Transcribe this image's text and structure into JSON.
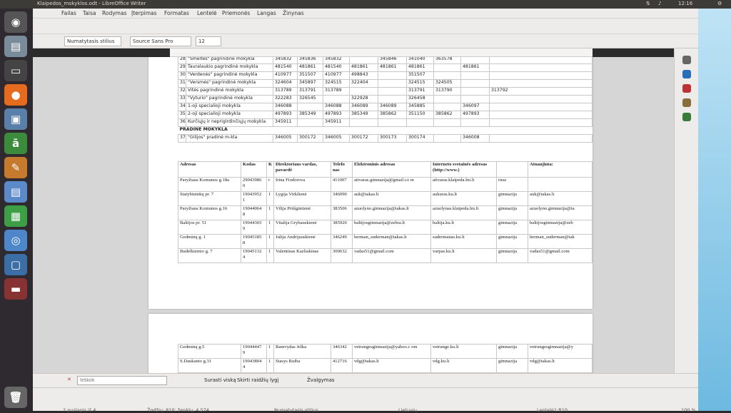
{
  "window": {
    "title": "Klaipedos_mokyklos.odt - LibreOffice Writer",
    "clock": "12:16"
  },
  "menu": [
    "Failas",
    "Taisa",
    "Rodymas",
    "Įterpimas",
    "Formatas",
    "Lentelė",
    "Priemonės",
    "Langas",
    "Žinynas"
  ],
  "toolbar2": {
    "style": "Numatytasis stilius",
    "font": "Source Sans Pro",
    "size": "12"
  },
  "table1": {
    "rows": [
      [
        "28",
        "\"Smeltės\" pagrindinė mokykla",
        "345832",
        "345836",
        "345832",
        "",
        "345846",
        "341040",
        "363578",
        "",
        ""
      ],
      [
        "29",
        "Tauralaukio pagrindinė mokykla",
        "481540",
        "481861",
        "481540",
        "481861",
        "481861",
        "481861",
        "",
        "481861",
        ""
      ],
      [
        "30",
        "\"Verdenės\" pagrindinė mokykla",
        "410977",
        "351507",
        "410977",
        "498843",
        "",
        "351507",
        "",
        "",
        ""
      ],
      [
        "31",
        "\"Versmės\" pagrindinė mokykla",
        "324604",
        "345897",
        "324515",
        "322404",
        "",
        "324515",
        "324505",
        "",
        ""
      ],
      [
        "32",
        "Vitės pagrindinė mokykla",
        "313789",
        "313791",
        "313789",
        "",
        "",
        "313791",
        "313790",
        "",
        "313792"
      ],
      [
        "33",
        "\"Vyturio\" pagrindinė mokykla",
        "322283",
        "326545",
        "",
        "322928",
        "",
        "326458",
        "",
        "",
        ""
      ],
      [
        "34",
        "1-oji specialioji mokykla",
        "346088",
        "",
        "346088",
        "346089",
        "346089",
        "345885",
        "",
        "346097",
        ""
      ],
      [
        "35",
        "2-oji specialioji mokykla",
        "497893",
        "385349",
        "497893",
        "385349",
        "385862",
        "351150",
        "385862",
        "497893",
        ""
      ],
      [
        "36",
        "Kurčiųjų ir neprigirdinčiųjų mokykla",
        "345911",
        "",
        "345911",
        "",
        "",
        "",
        "",
        "",
        ""
      ]
    ],
    "section": "PRADINĖ MOKYKLA",
    "last": [
      "37",
      "\"Gilijos\" pradinė m-kla",
      "346005",
      "300172",
      "346005",
      "300172",
      "300173",
      "300174",
      "",
      "346008",
      ""
    ]
  },
  "table2": {
    "headers": [
      "Adresas",
      "Kodas",
      "K",
      "Direktoriaus vardas, pavardė",
      "Telefo nas",
      "Elektroninis adresas",
      "Interneto svetainės adresas (http://www.)",
      "",
      "Atnaujinta:"
    ],
    "rows": [
      [
        "Paryžiaus Komunos g.18a",
        "29043986 0",
        "r",
        "Irina Fiodorova",
        "411007",
        "aitvaras.gimnazija@gmail.co m",
        "aitvaras.klaipeda.lm.lt",
        "rusa",
        ""
      ],
      [
        "Statybininkų pr. 7",
        "19043952 1",
        "1",
        "Lygija Virkšienė",
        "346090",
        "auk@takas.lt",
        "aukuras.ku.lt",
        "gimnazija",
        "auk@takas.lt"
      ],
      [
        "Paryžiaus Komunos g.16",
        "19044064 8",
        "1",
        "Vilija Prūšgintienė",
        "383506",
        "azuolyno.gimnazija@takas.lt",
        "azuolynas.klaipeda.lm.lt",
        "gimnazija",
        "azuolyno.gimnazija@ta"
      ],
      [
        "Baltijos pr. 51",
        "19044303 9",
        "1",
        "Vitalija Grybauskienė",
        "385920",
        "baltijosgimnazija@zebra.lt",
        "baltija.ku.lt",
        "gimnazija",
        "baltijosgimnazija@zeb"
      ],
      [
        "Gedminų g. 1",
        "19045185 8",
        "1",
        "Julija Andrijauskienė",
        "346249",
        "herman_suderman@takas.lt",
        "sudermanas.ku.lt",
        "gimnazija",
        "herman_suderman@tak"
      ],
      [
        "Budelkiemio g. 7",
        "19045132 4",
        "1",
        "Valentinas Kazliakinas",
        "300632",
        "vadas51@gmail.com",
        "varpas.ku.lt",
        "gimnazija",
        "vadas51@gmail.com"
      ]
    ]
  },
  "table3": {
    "rows": [
      [
        "Gedminų g.5",
        "19044447 9",
        "1",
        "Ramvydas Jelka",
        "346342",
        "vetrungesgimnazija@yahoo.c om",
        "vetrunge.ku.lt",
        "gimnazija",
        "vetrungesgimnazija@y"
      ],
      [
        "S.Daukanto g.31",
        "19043804 4",
        "1",
        "Stasys Ruiba",
        "412716",
        "vdg@takas.lt",
        "vdg.ku.lt",
        "gimnazija",
        "vdg@takas.lt"
      ]
    ]
  },
  "findbar": {
    "placeholder": "Ieškoti",
    "find_all": "Surasti viską",
    "match_case": "Skirti raidžių lygį",
    "formatting": "Žvalgymas"
  },
  "status": {
    "page": "2 puslapis iš 4",
    "words": "Žodžių: 810; ženklų: 4 574",
    "style": "Numatytasis stilius",
    "lang": "Lietuvių",
    "pos": "Lentelė1:B10",
    "zoom": "100 %"
  }
}
